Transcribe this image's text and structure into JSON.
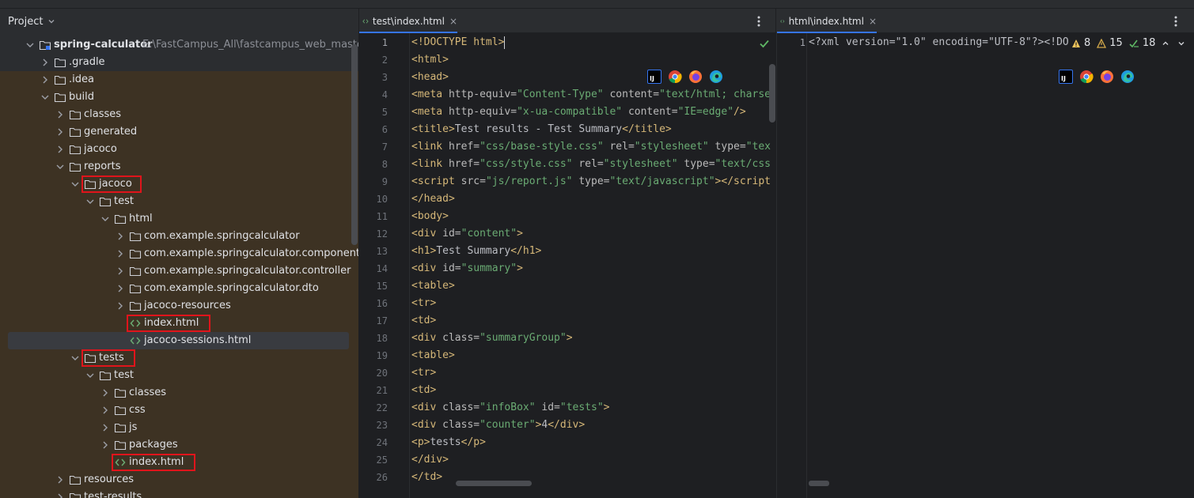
{
  "project_panel": {
    "title": "Project",
    "tree": [
      {
        "label": "spring-calculator",
        "path": "E:\\FastCampus_All\\fastcampus_web_master\\sp",
        "depth": 0,
        "expanded": true,
        "type": "module",
        "bold": true
      },
      {
        "label": ".gradle",
        "depth": 1,
        "expanded": false,
        "type": "folder"
      },
      {
        "label": ".idea",
        "depth": 1,
        "expanded": false,
        "type": "folder"
      },
      {
        "label": "build",
        "depth": 1,
        "expanded": true,
        "type": "folder"
      },
      {
        "label": "classes",
        "depth": 2,
        "expanded": false,
        "type": "folder"
      },
      {
        "label": "generated",
        "depth": 2,
        "expanded": false,
        "type": "folder"
      },
      {
        "label": "jacoco",
        "depth": 2,
        "expanded": false,
        "type": "folder"
      },
      {
        "label": "reports",
        "depth": 2,
        "expanded": true,
        "type": "folder"
      },
      {
        "label": "jacoco",
        "depth": 3,
        "expanded": true,
        "type": "folder",
        "highlight": true
      },
      {
        "label": "test",
        "depth": 4,
        "expanded": true,
        "type": "folder"
      },
      {
        "label": "html",
        "depth": 5,
        "expanded": true,
        "type": "folder"
      },
      {
        "label": "com.example.springcalculator",
        "depth": 6,
        "expanded": false,
        "type": "folder"
      },
      {
        "label": "com.example.springcalculator.component",
        "depth": 6,
        "expanded": false,
        "type": "folder"
      },
      {
        "label": "com.example.springcalculator.controller",
        "depth": 6,
        "expanded": false,
        "type": "folder"
      },
      {
        "label": "com.example.springcalculator.dto",
        "depth": 6,
        "expanded": false,
        "type": "folder"
      },
      {
        "label": "jacoco-resources",
        "depth": 6,
        "expanded": false,
        "type": "folder"
      },
      {
        "label": "index.html",
        "depth": 6,
        "type": "html",
        "highlight": true
      },
      {
        "label": "jacoco-sessions.html",
        "depth": 6,
        "type": "html",
        "selected": true
      },
      {
        "label": "tests",
        "depth": 3,
        "expanded": true,
        "type": "folder",
        "highlight": true
      },
      {
        "label": "test",
        "depth": 4,
        "expanded": true,
        "type": "folder"
      },
      {
        "label": "classes",
        "depth": 5,
        "expanded": false,
        "type": "folder"
      },
      {
        "label": "css",
        "depth": 5,
        "expanded": false,
        "type": "folder"
      },
      {
        "label": "js",
        "depth": 5,
        "expanded": false,
        "type": "folder"
      },
      {
        "label": "packages",
        "depth": 5,
        "expanded": false,
        "type": "folder"
      },
      {
        "label": "index.html",
        "depth": 5,
        "type": "html",
        "highlight": true
      },
      {
        "label": "resources",
        "depth": 2,
        "expanded": false,
        "type": "folder"
      },
      {
        "label": "test-results",
        "depth": 2,
        "expanded": false,
        "type": "folder"
      }
    ]
  },
  "editor_left": {
    "tab_label": "test\\index.html",
    "tab_close": "×",
    "lines": [
      [
        [
          "tg",
          "<!DOCTYPE html>"
        ]
      ],
      [
        [
          "tg",
          "<html>"
        ]
      ],
      [
        [
          "tg",
          "<head>"
        ]
      ],
      [
        [
          "tg",
          "<meta "
        ],
        [
          "at",
          "http-equiv="
        ],
        [
          "sv",
          "\"Content-Type\""
        ],
        [
          "at",
          " content="
        ],
        [
          "sv",
          "\"text/html; charset"
        ]
      ],
      [
        [
          "tg",
          "<meta "
        ],
        [
          "at",
          "http-equiv="
        ],
        [
          "sv",
          "\"x-ua-compatible\""
        ],
        [
          "at",
          " content="
        ],
        [
          "sv",
          "\"IE=edge\""
        ],
        [
          "tg",
          "/>"
        ]
      ],
      [
        [
          "tg",
          "<title>"
        ],
        [
          "tx",
          "Test results - Test Summary"
        ],
        [
          "tg",
          "</title>"
        ]
      ],
      [
        [
          "tg",
          "<link "
        ],
        [
          "at",
          "href="
        ],
        [
          "sv",
          "\"css/base-style.css\""
        ],
        [
          "at",
          " rel="
        ],
        [
          "sv",
          "\"stylesheet\""
        ],
        [
          "at",
          " type="
        ],
        [
          "sv",
          "\"tex"
        ]
      ],
      [
        [
          "tg",
          "<link "
        ],
        [
          "at",
          "href="
        ],
        [
          "sv",
          "\"css/style.css\""
        ],
        [
          "at",
          " rel="
        ],
        [
          "sv",
          "\"stylesheet\""
        ],
        [
          "at",
          " type="
        ],
        [
          "sv",
          "\"text/css"
        ]
      ],
      [
        [
          "tg",
          "<script "
        ],
        [
          "at",
          "src="
        ],
        [
          "sv",
          "\"js/report.js\""
        ],
        [
          "at",
          " type="
        ],
        [
          "sv",
          "\"text/javascript\""
        ],
        [
          "tg",
          "></script"
        ]
      ],
      [
        [
          "tg",
          "</head>"
        ]
      ],
      [
        [
          "tg",
          "<body>"
        ]
      ],
      [
        [
          "tg",
          "<div "
        ],
        [
          "at",
          "id="
        ],
        [
          "sv",
          "\"content\""
        ],
        [
          "tg",
          ">"
        ]
      ],
      [
        [
          "tg",
          "<h1>"
        ],
        [
          "tx",
          "Test Summary"
        ],
        [
          "tg",
          "</h1>"
        ]
      ],
      [
        [
          "tg",
          "<div "
        ],
        [
          "at",
          "id="
        ],
        [
          "sv",
          "\"summary\""
        ],
        [
          "tg",
          ">"
        ]
      ],
      [
        [
          "tg",
          "<table>"
        ]
      ],
      [
        [
          "tg",
          "<tr>"
        ]
      ],
      [
        [
          "tg",
          "<td>"
        ]
      ],
      [
        [
          "tg",
          "<div "
        ],
        [
          "at",
          "class="
        ],
        [
          "sv",
          "\"summaryGroup\""
        ],
        [
          "tg",
          ">"
        ]
      ],
      [
        [
          "tg",
          "<table>"
        ]
      ],
      [
        [
          "tg",
          "<tr>"
        ]
      ],
      [
        [
          "tg",
          "<td>"
        ]
      ],
      [
        [
          "tg",
          "<div "
        ],
        [
          "at",
          "class="
        ],
        [
          "sv",
          "\"infoBox\""
        ],
        [
          "at",
          " id="
        ],
        [
          "sv",
          "\"tests\""
        ],
        [
          "tg",
          ">"
        ]
      ],
      [
        [
          "tg",
          "<div "
        ],
        [
          "at",
          "class="
        ],
        [
          "sv",
          "\"counter\""
        ],
        [
          "tg",
          ">"
        ],
        [
          "tx",
          "4"
        ],
        [
          "tg",
          "</div>"
        ]
      ],
      [
        [
          "tg",
          "<p>"
        ],
        [
          "tx",
          "tests"
        ],
        [
          "tg",
          "</p>"
        ]
      ],
      [
        [
          "tg",
          "</div>"
        ]
      ],
      [
        [
          "tg",
          "</td>"
        ]
      ]
    ],
    "line_numbers": [
      "1",
      "2",
      "3",
      "4",
      "5",
      "6",
      "7",
      "8",
      "9",
      "10",
      "11",
      "12",
      "13",
      "14",
      "15",
      "16",
      "17",
      "18",
      "19",
      "20",
      "21",
      "22",
      "23",
      "24",
      "25",
      "26"
    ]
  },
  "editor_right": {
    "tab_label": "html\\index.html",
    "tab_close": "×",
    "line_numbers": [
      "1"
    ],
    "lines": [
      [
        [
          "tx",
          "<?xml version=\"1.0\" encoding=\"UTF-8\"?><!DO"
        ]
      ]
    ],
    "inspections": {
      "warnings": "8",
      "weak_warnings": "15",
      "ok": "18"
    }
  },
  "colors": {
    "accent": "#3574f0",
    "highlight_box": "#e0141b",
    "excluded_bg": "#3d3223"
  }
}
